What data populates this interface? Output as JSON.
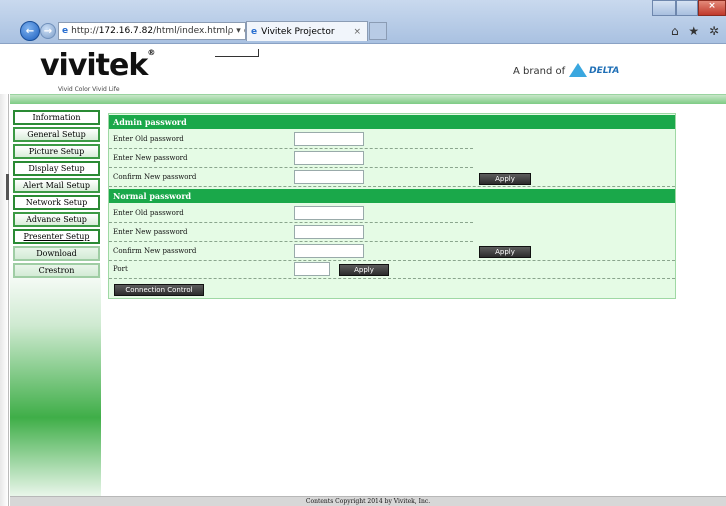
{
  "browser": {
    "address_prefix": "http://",
    "address_host": "172.16.7.82",
    "address_path": "/html/index.html",
    "address_tools": "ρ ▾ ¢ ✕",
    "tab_title": "Vivitek Projector",
    "tab_close": "×",
    "toolbar_icons": "⌂ ★ ✲"
  },
  "header": {
    "logo": "vivitek",
    "logo_mark": "®",
    "tagline": "Vivid Color Vivid Life",
    "brand_prefix": "A brand of",
    "brand_name": "DELTA"
  },
  "sidebar": {
    "items": [
      {
        "label": "Information"
      },
      {
        "label": "General Setup"
      },
      {
        "label": "Picture Setup"
      },
      {
        "label": "Display Setup"
      },
      {
        "label": "Alert Mail Setup"
      },
      {
        "label": "Network Setup"
      },
      {
        "label": "Advance Setup"
      },
      {
        "label": "Presenter Setup"
      },
      {
        "label": "Download"
      },
      {
        "label": "Crestron"
      }
    ]
  },
  "admin": {
    "heading": "Admin password",
    "old_label": "Enter Old password",
    "new_label": "Enter New password",
    "confirm_label": "Confirm New password",
    "apply": "Apply"
  },
  "normal": {
    "heading": "Normal password",
    "old_label": "Enter Old password",
    "new_label": "Enter New password",
    "confirm_label": "Confirm New password",
    "apply": "Apply"
  },
  "port": {
    "label": "Port",
    "value": "",
    "apply": "Apply"
  },
  "connection_control": "Connection Control",
  "footer": "Contents Copyright 2014 by Vivitek, Inc.",
  "colors": {
    "section_header": "#1aa84a",
    "panel_bg": "#e5fbe5",
    "menu_border": "#2a8a34"
  }
}
